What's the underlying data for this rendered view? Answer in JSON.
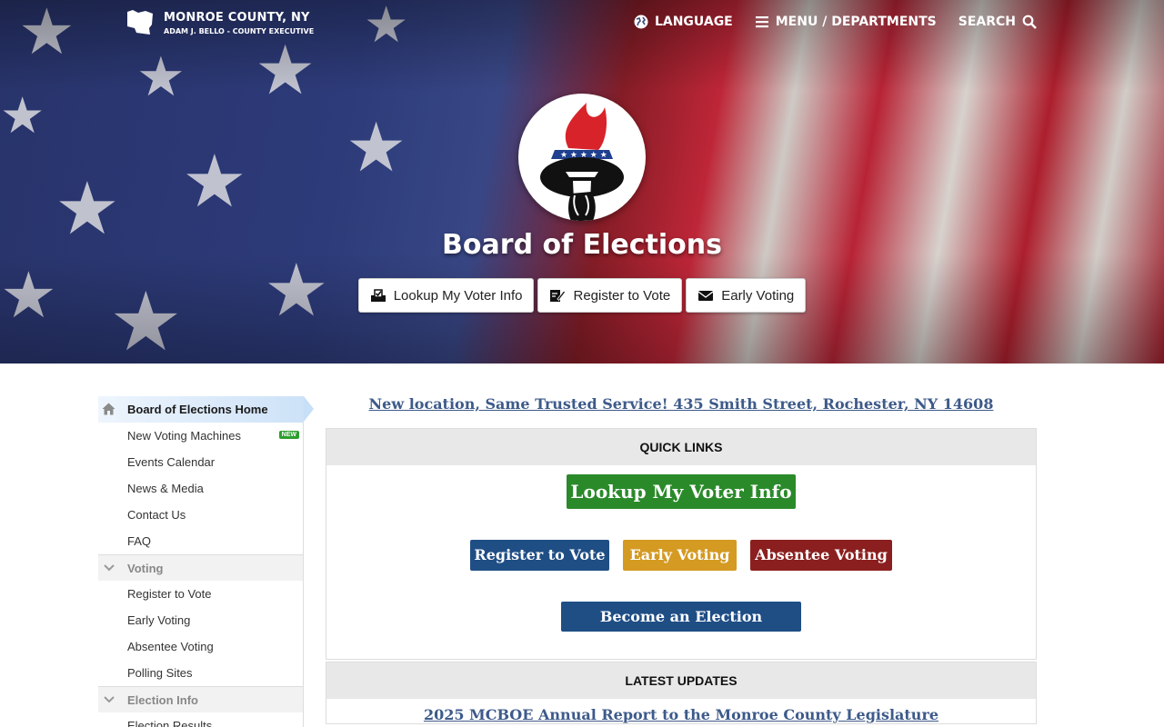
{
  "header": {
    "county_name": "MONROE COUNTY, NY",
    "executive": "ADAM J. BELLO - COUNTY EXECUTIVE",
    "nav": [
      {
        "label": "LANGUAGE",
        "icon": "globe-icon"
      },
      {
        "label": "MENU / DEPARTMENTS",
        "icon": "hamburger-icon"
      },
      {
        "label": "SEARCH",
        "icon": "search-icon"
      }
    ]
  },
  "hero": {
    "title": "Board of Elections",
    "buttons": [
      {
        "label": "Lookup My Voter Info",
        "icon": "ballot-box-icon"
      },
      {
        "label": "Register to Vote",
        "icon": "sign-document-icon"
      },
      {
        "label": "Early Voting",
        "icon": "envelope-icon"
      }
    ]
  },
  "sidebar": {
    "home": "Board of Elections Home",
    "items": [
      {
        "label": "New Voting Machines",
        "badge": "NEW"
      },
      {
        "label": "Events Calendar"
      },
      {
        "label": "News & Media"
      },
      {
        "label": "Contact Us"
      },
      {
        "label": "FAQ"
      }
    ],
    "sections": [
      {
        "title": "Voting",
        "items": [
          "Register to Vote",
          "Early Voting",
          "Absentee Voting",
          "Polling Sites"
        ]
      },
      {
        "title": "Election Info",
        "items": [
          "Election Results"
        ]
      }
    ]
  },
  "main": {
    "notice": "New location, Same Trusted Service! 435 Smith Street, Rochester, NY 14608",
    "quick_links": {
      "heading": "QUICK LINKS",
      "primary": "Lookup My Voter Info",
      "row": [
        "Register to Vote",
        "Early Voting",
        "Absentee Voting"
      ],
      "inspector": "Become an Election Inspector"
    },
    "latest_updates": {
      "heading": "LATEST UPDATES",
      "first": "2025 MCBOE Annual Report to the Monroe County Legislature"
    }
  },
  "colors": {
    "green": "#2a8a2a",
    "blue": "#1f4e85",
    "gold": "#d49a22",
    "maroon": "#8b1f1f",
    "link": "#3d5a8a"
  }
}
